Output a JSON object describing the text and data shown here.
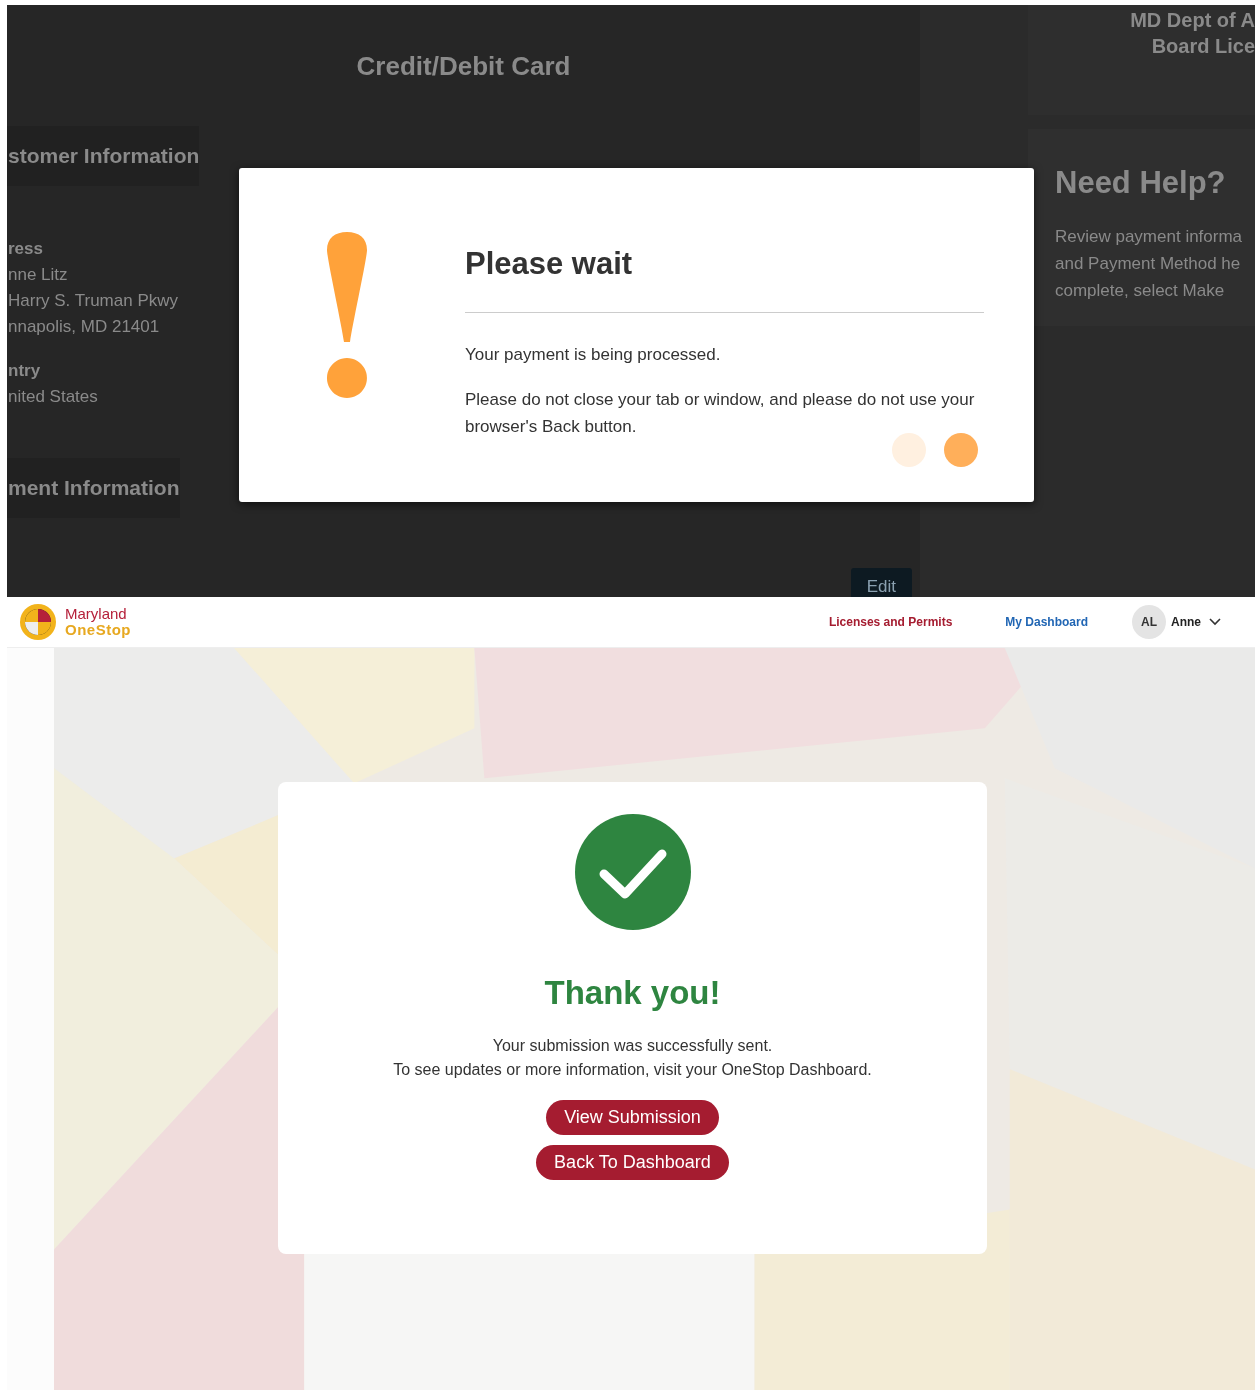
{
  "background_page": {
    "title": "Credit/Debit Card",
    "sections": [
      {
        "heading": "stomer Information",
        "fields": [
          {
            "label": "ress",
            "lines": [
              "nne Litz",
              "Harry S. Truman Pkwy",
              "nnapolis, MD 21401"
            ]
          },
          {
            "label": "ntry",
            "lines": [
              "nited States"
            ]
          }
        ]
      },
      {
        "heading": "ment Information"
      }
    ],
    "edit_button": "Edit",
    "agency_lines": [
      "MD Dept of A",
      "Board Lice"
    ],
    "help": {
      "title": "Need Help?",
      "lines": [
        "Review payment informa",
        "and Payment Method he",
        "complete, select Make"
      ]
    }
  },
  "modal": {
    "title": "Please wait",
    "messages": [
      "Your payment is being processed.",
      "Please do not close your tab or window, and please do not use your browser's Back button."
    ],
    "dots": [
      {
        "active": false
      },
      {
        "active": true
      }
    ]
  },
  "header": {
    "logo": [
      "Maryland",
      "OneStop"
    ],
    "nav": [
      {
        "label": "Licenses and Permits",
        "kind": "primary"
      },
      {
        "label": "My Dashboard",
        "kind": "secondary"
      }
    ],
    "user": {
      "initials": "AL",
      "name": "Anne"
    }
  },
  "confirmation": {
    "title": "Thank you!",
    "lines": [
      "Your submission was successfully sent.",
      "To see updates or more information, visit your OneStop Dashboard."
    ],
    "buttons": [
      "View Submission",
      "Back To Dashboard"
    ]
  }
}
